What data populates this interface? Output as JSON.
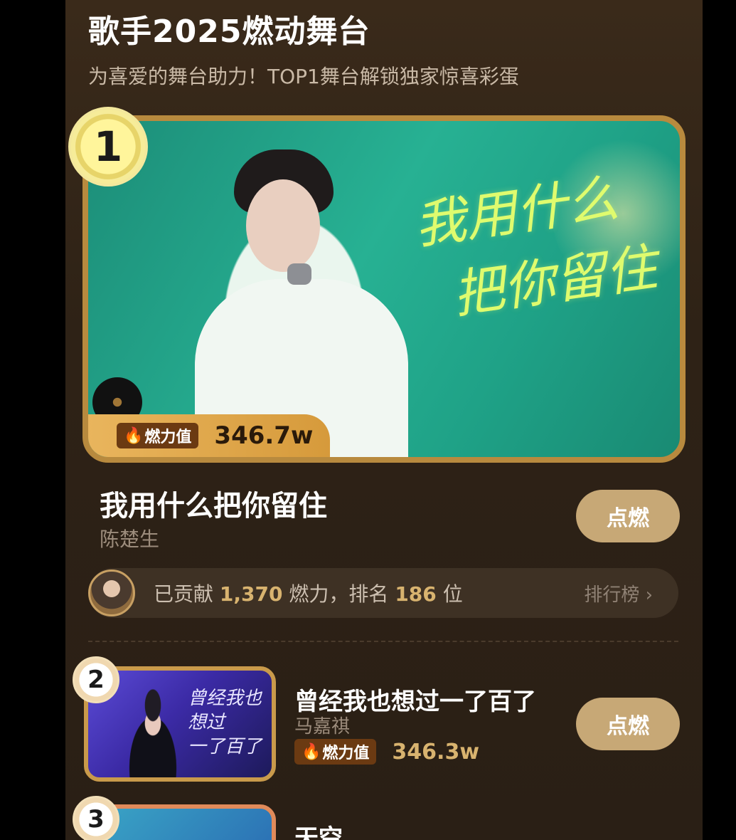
{
  "header": {
    "title": "歌手2025燃动舞台",
    "subtitle": "为喜爱的舞台助力！TOP1舞台解锁独家惊喜彩蛋"
  },
  "top_item": {
    "rank": "1",
    "cover_lyric_line1": "我用什么",
    "cover_lyric_line2": "把你留住",
    "heat_label": "燃力值",
    "heat_value": "346.7w",
    "song": "我用什么把你留住",
    "artist": "陈楚生",
    "button": "点燃"
  },
  "contribution": {
    "prefix": "已贡献",
    "points": "1,370",
    "points_unit": "燃力，排名",
    "rank": "186",
    "rank_unit": "位",
    "leaderboard_link": "排行榜"
  },
  "items": [
    {
      "rank": "2",
      "cover_script_line1": "曾经我也想过",
      "cover_script_line2": "一了百了",
      "song": "曾经我也想过一了百了",
      "artist": "马嘉祺",
      "heat_label": "燃力值",
      "heat_value": "346.3w",
      "button": "点燃"
    },
    {
      "rank": "3",
      "song": "天空"
    }
  ]
}
